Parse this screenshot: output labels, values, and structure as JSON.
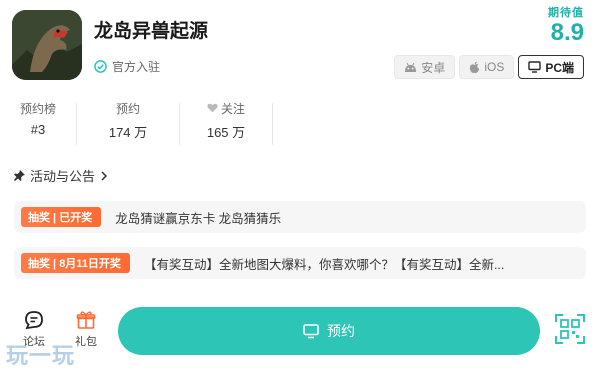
{
  "app": {
    "title": "龙岛异兽起源",
    "official_label": "官方入驻"
  },
  "rating": {
    "label": "期待值",
    "value": "8.9"
  },
  "platforms": [
    {
      "label": "安卓",
      "icon": "android-icon",
      "active": false
    },
    {
      "label": "iOS",
      "icon": "apple-icon",
      "active": false
    },
    {
      "label": "PC端",
      "icon": "monitor-icon",
      "active": true
    }
  ],
  "stats": [
    {
      "label": "预约榜",
      "value": "#3"
    },
    {
      "label": "预约",
      "value": "174 万"
    },
    {
      "label": "关注",
      "value": "165 万",
      "icon": "heart-icon"
    }
  ],
  "section": {
    "title": "活动与公告",
    "icon": "pin-icon"
  },
  "news": [
    {
      "tag": "抽奖 | 已开奖",
      "text": "龙岛猜谜赢京东卡 龙岛猜猜乐"
    },
    {
      "tag": "抽奖 | 8月11日开奖",
      "text": "【有奖互动】全新地图大爆料，你喜欢哪个？【有奖互动】全新..."
    }
  ],
  "bottom_bar": {
    "forum_label": "论坛",
    "gift_label": "礼包",
    "reserve_label": "预约"
  },
  "watermark": "玩一玩",
  "colors": {
    "accent": "#2cc5b6",
    "tag": "#ff6a33",
    "rating": "#20b2aa"
  }
}
